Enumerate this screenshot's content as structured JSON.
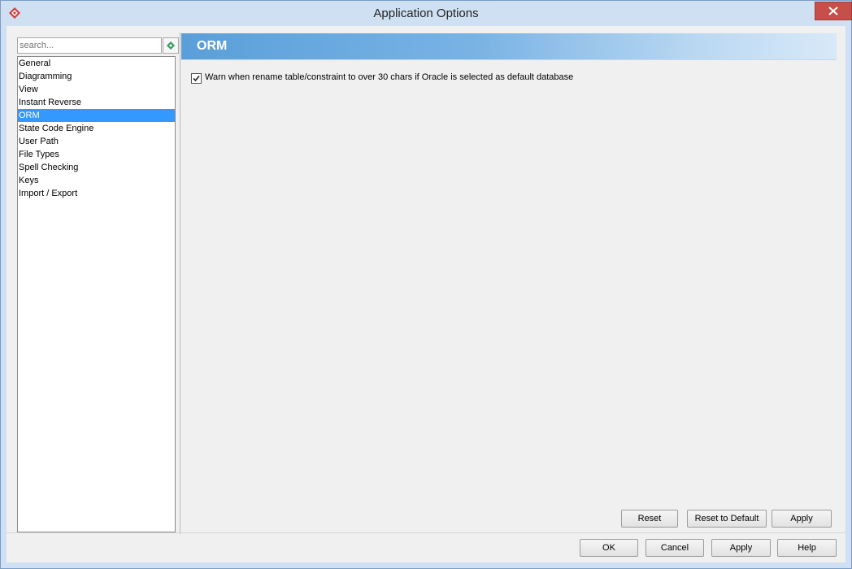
{
  "window": {
    "title": "Application Options",
    "icon": "visual-paradigm-icon",
    "close_icon": "close-icon"
  },
  "sidebar": {
    "search_placeholder": "search...",
    "search_icon": "search-go-icon",
    "items": [
      {
        "label": "General"
      },
      {
        "label": "Diagramming"
      },
      {
        "label": "View"
      },
      {
        "label": "Instant Reverse"
      },
      {
        "label": "ORM",
        "selected": true
      },
      {
        "label": "State Code Engine"
      },
      {
        "label": "User Path"
      },
      {
        "label": "File Types"
      },
      {
        "label": "Spell Checking"
      },
      {
        "label": "Keys"
      },
      {
        "label": "Import / Export"
      }
    ]
  },
  "panel": {
    "title": "ORM",
    "options": [
      {
        "label": "Warn when rename table/constraint to over 30 chars if Oracle is selected as default database",
        "checked": true
      }
    ],
    "buttons": {
      "reset": "Reset",
      "reset_default": "Reset to Default",
      "apply": "Apply"
    }
  },
  "dialog_buttons": {
    "ok": "OK",
    "cancel": "Cancel",
    "apply": "Apply",
    "help": "Help"
  },
  "colors": {
    "selection": "#3399ff",
    "header_gradient_start": "#5a9fd9",
    "close_button": "#c74f4a"
  }
}
